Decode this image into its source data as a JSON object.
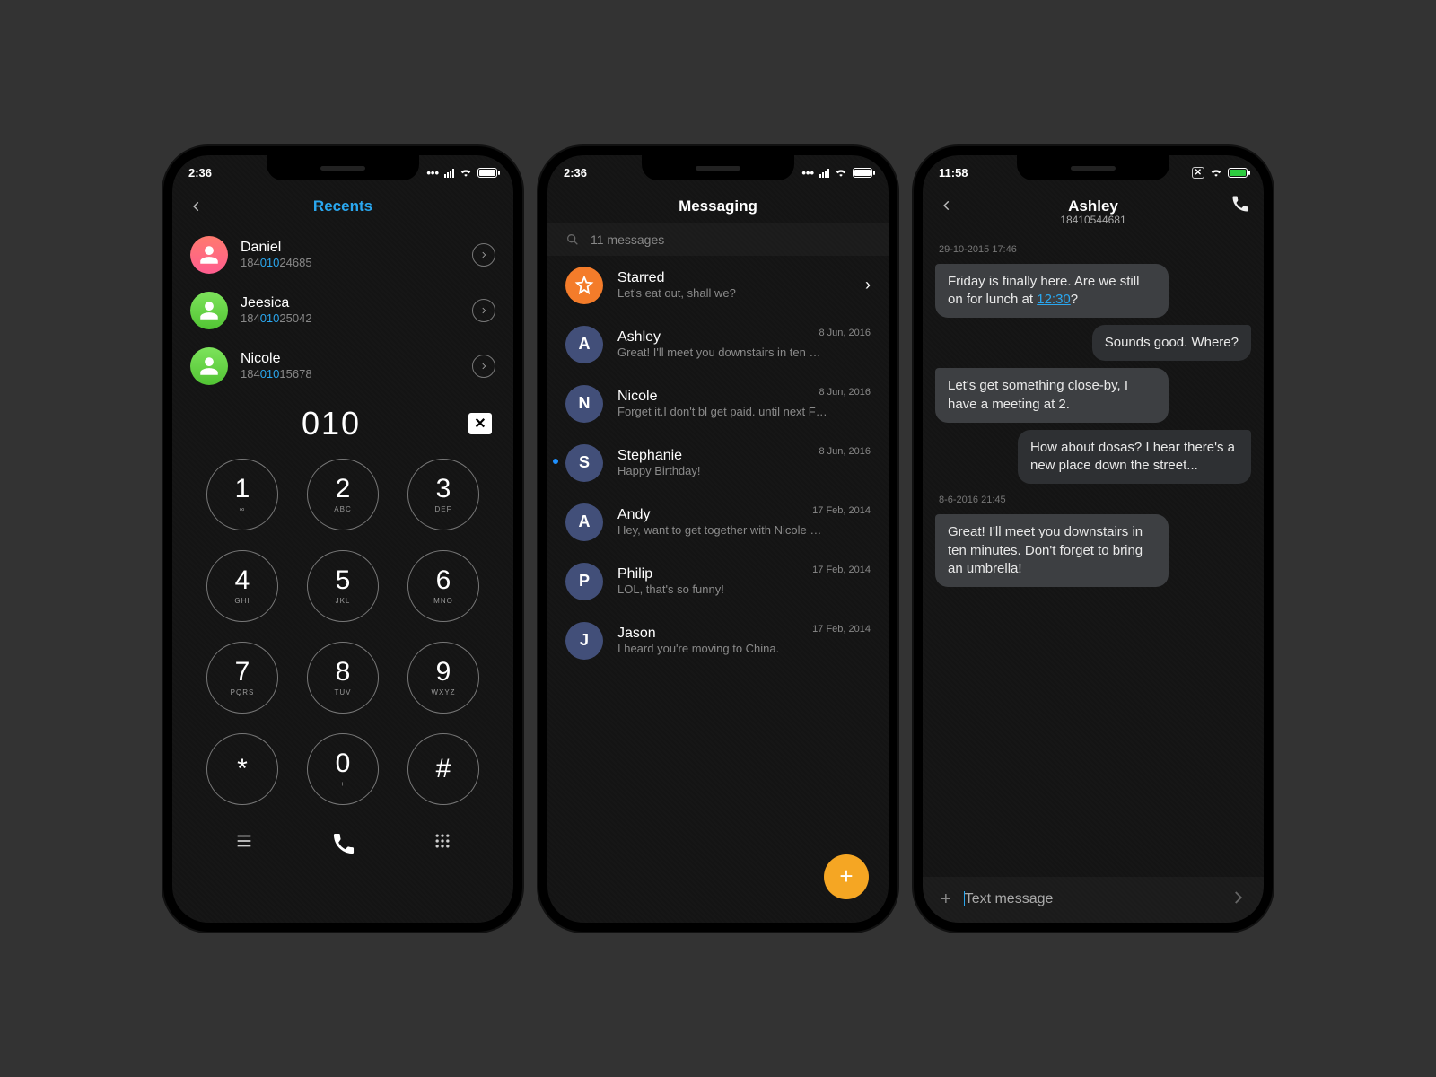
{
  "phone1": {
    "status_time": "2:36",
    "title": "Recents",
    "contacts": [
      {
        "name": "Daniel",
        "phone_pre": "184",
        "phone_hl": "010",
        "phone_post": "24685",
        "avatar_color": "av-pink"
      },
      {
        "name": "Jeesica",
        "phone_pre": "184",
        "phone_hl": "010",
        "phone_post": "25042",
        "avatar_color": "av-green"
      },
      {
        "name": "Nicole",
        "phone_pre": "184",
        "phone_hl": "010",
        "phone_post": "15678",
        "avatar_color": "av-green"
      }
    ],
    "typed": "010",
    "keys": [
      {
        "d": "1",
        "l": "∞"
      },
      {
        "d": "2",
        "l": "ABC"
      },
      {
        "d": "3",
        "l": "DEF"
      },
      {
        "d": "4",
        "l": "GHI"
      },
      {
        "d": "5",
        "l": "JKL"
      },
      {
        "d": "6",
        "l": "MNO"
      },
      {
        "d": "7",
        "l": "PQRS"
      },
      {
        "d": "8",
        "l": "TUV"
      },
      {
        "d": "9",
        "l": "WXYZ"
      },
      {
        "d": "*",
        "l": ""
      },
      {
        "d": "0",
        "l": "+"
      },
      {
        "d": "#",
        "l": ""
      }
    ]
  },
  "phone2": {
    "status_time": "2:36",
    "title": "Messaging",
    "search_placeholder": "11 messages",
    "starred": {
      "name": "Starred",
      "preview": "Let's eat out, shall we?"
    },
    "items": [
      {
        "letter": "A",
        "name": "Ashley",
        "preview": "Great! I'll meet you downstairs in ten …",
        "date": "8 Jun, 2016"
      },
      {
        "letter": "N",
        "name": "Nicole",
        "preview": "Forget it.I don't bl get paid. until next F…",
        "date": "8 Jun, 2016"
      },
      {
        "letter": "S",
        "name": "Stephanie",
        "preview": "Happy Birthday!",
        "date": "8 Jun, 2016",
        "unread": true
      },
      {
        "letter": "A",
        "name": "Andy",
        "preview": "Hey, want to get together with Nicole …",
        "date": "17 Feb, 2014"
      },
      {
        "letter": "P",
        "name": "Philip",
        "preview": "LOL, that's so funny!",
        "date": "17 Feb, 2014"
      },
      {
        "letter": "J",
        "name": "Jason",
        "preview": "I heard you're moving to China.",
        "date": "17 Feb, 2014"
      }
    ]
  },
  "phone3": {
    "status_time": "11:58",
    "title": "Ashley",
    "subtitle": "18410544681",
    "ts1": "29-10-2015 17:46",
    "ts2": "8-6-2016 21:45",
    "m1_pre": "Friday is finally here. Are we still on for lunch at ",
    "m1_link": "12:30",
    "m1_post": "?",
    "m2": "Sounds good. Where?",
    "m3": "Let's get something close-by, I have a meeting at 2.",
    "m4": "How about dosas? I hear there's a new place down the street...",
    "m5": "Great! I'll meet you downstairs in ten minutes. Don't forget to bring an umbrella!",
    "compose_placeholder": "Text message"
  }
}
